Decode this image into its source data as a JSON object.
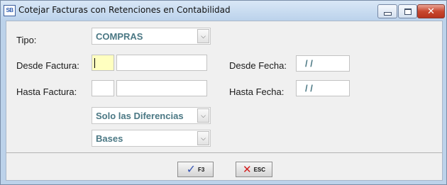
{
  "window": {
    "app_icon_text": "SB",
    "title": "Cotejar Facturas con Retenciones en Contabilidad",
    "controls": {
      "close_glyph": "✕"
    }
  },
  "form": {
    "tipo": {
      "label": "Tipo:",
      "value": "COMPRAS"
    },
    "desde_factura": {
      "label": "Desde Factura:",
      "serie": "",
      "numero": ""
    },
    "hasta_factura": {
      "label": "Hasta Factura:",
      "serie": "",
      "numero": ""
    },
    "desde_fecha": {
      "label": "Desde Fecha:",
      "value": "/ /"
    },
    "hasta_fecha": {
      "label": "Hasta Fecha:",
      "value": "/ /"
    },
    "filtro": {
      "value": "Solo las Diferencias"
    },
    "modo": {
      "value": "Bases"
    },
    "dropdown_glyph": "⌵"
  },
  "buttons": {
    "ok": {
      "glyph": "✓",
      "label": "F3",
      "icon": "checkmark-icon"
    },
    "esc": {
      "glyph": "✕",
      "label": "ESC",
      "icon": "red-x-icon"
    }
  },
  "colors": {
    "value_text": "#4b7884",
    "focus_field": "#ffffc0",
    "titlebar": "#bcd3ec"
  }
}
